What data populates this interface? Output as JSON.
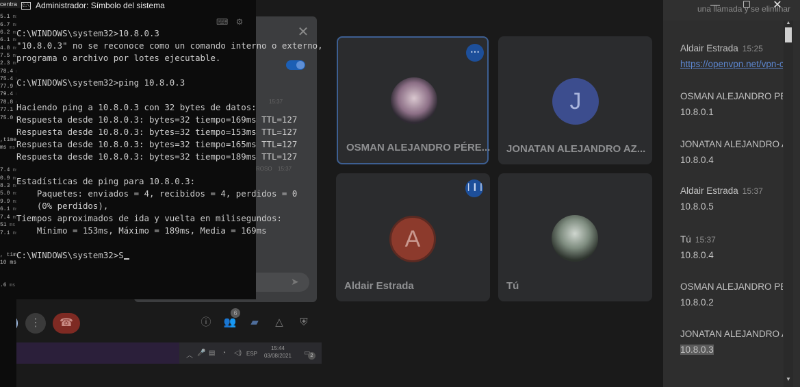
{
  "left_terminal": {
    "partial_label": "centra",
    "rows": [
      "5.1",
      "6.7",
      "6.2",
      "6.1",
      "4.8",
      "7.5",
      "2.3",
      "78.4",
      "75.4",
      "77.9",
      "79.4",
      "78.8",
      "77.1",
      "75.0",
      "",
      ",time 38ms",
      "ms",
      "7.4",
      "0.9",
      "8.3",
      "5.0",
      "9.9",
      "6.1",
      "7.4",
      "51",
      "7.1",
      ", tim",
      "10 ms",
      ".6"
    ],
    "unit": "ms"
  },
  "cmd": {
    "title": "Administrador: Símbolo del sistema",
    "icon_label": "C:\\",
    "lines": [
      "C:\\WINDOWS\\system32>10.8.0.3",
      "\"10.8.0.3\" no se reconoce como un comando interno o externo,",
      "programa o archivo por lotes ejecutable.",
      "",
      "C:\\WINDOWS\\system32>ping 10.8.0.3",
      "",
      "Haciendo ping a 10.8.0.3 con 32 bytes de datos:",
      "Respuesta desde 10.8.0.3: bytes=32 tiempo=169ms TTL=127",
      "Respuesta desde 10.8.0.3: bytes=32 tiempo=153ms TTL=127",
      "Respuesta desde 10.8.0.3: bytes=32 tiempo=165ms TTL=127",
      "Respuesta desde 10.8.0.3: bytes=32 tiempo=189ms TTL=127",
      "",
      "Estadísticas de ping para 10.8.0.3:",
      "    Paquetes: enviados = 4, recibidos = 4, perdidos = 0",
      "    (0% perdidos),",
      "Tiempos aproximados de ida y vuelta en milisegundos:",
      "    Mínimo = 153ms, Máximo = 189ms, Media = 169ms",
      "",
      "C:\\WINDOWS\\system32>S"
    ]
  },
  "meet": {
    "participants": [
      {
        "name": "OSMAN ALEJANDRO PÉRE...",
        "avatar_letter": ""
      },
      {
        "name": "JONATAN ALEJANDRO AZ...",
        "avatar_letter": "J"
      },
      {
        "name": "Aldair Estrada",
        "avatar_letter": "A"
      },
      {
        "name": "Tú",
        "avatar_letter": ""
      }
    ],
    "chat_panel_faint": {
      "time1": "15:37",
      "sender_partial": "ROSO",
      "time2": "15:37",
      "time_label": "time 38ms"
    },
    "people_count": "6"
  },
  "taskbar": {
    "time": "15:44",
    "date": "03/08/2021",
    "lang": "ESP",
    "notifications": "2"
  },
  "side_chat": {
    "notice": "una llamada y se eliminar",
    "messages": [
      {
        "sender": "Aldair Estrada",
        "time": "15:25",
        "body": "https://openvpn.net/vpn-clie",
        "is_link": true
      },
      {
        "sender": "OSMAN ALEJANDRO PÉREZ",
        "time": "",
        "body": "10.8.0.1"
      },
      {
        "sender": "JONATAN ALEJANDRO AZUR",
        "time": "",
        "body": "10.8.0.4"
      },
      {
        "sender": "Aldair Estrada",
        "time": "15:37",
        "body": "10.8.0.5"
      },
      {
        "sender": "Tú",
        "time": "15:37",
        "body": "10.8.0.4"
      },
      {
        "sender": "OSMAN ALEJANDRO PÉREZ",
        "time": "",
        "body": "10.8.0.2"
      },
      {
        "sender": "JONATAN ALEJANDRO AZUR",
        "time": "",
        "body": "10.8.0.3"
      }
    ]
  }
}
